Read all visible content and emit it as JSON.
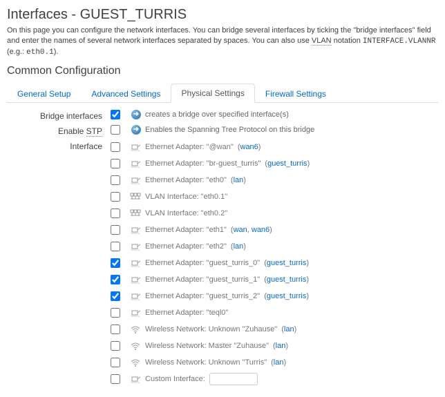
{
  "page": {
    "title": "Interfaces - GUEST_TURRIS",
    "description_pre": "On this page you can configure the network interfaces. You can bridge several interfaces by ticking the \"bridge interfaces\" field and enter the names of several network interfaces separated by spaces. You can also use ",
    "vlan_abbr": "VLAN",
    "description_mid": " notation ",
    "notation": "INTERFACE.VLANNR",
    "description_eg": " (e.g.: ",
    "notation_example": "eth0.1",
    "description_end": ").",
    "section_title": "Common Configuration"
  },
  "tabs": [
    {
      "label": "General Setup",
      "active": false
    },
    {
      "label": "Advanced Settings",
      "active": false
    },
    {
      "label": "Physical Settings",
      "active": true
    },
    {
      "label": "Firewall Settings",
      "active": false
    }
  ],
  "fields": {
    "bridge": {
      "label": "Bridge interfaces",
      "checked": true,
      "hint": "creates a bridge over specified interface(s)"
    },
    "stp": {
      "label_pre": "Enable ",
      "label_abbr": "STP",
      "checked": false,
      "hint": "Enables the Spanning Tree Protocol on this bridge"
    },
    "interface": {
      "label": "Interface"
    }
  },
  "interfaces": [
    {
      "checked": false,
      "icon": "eth",
      "text": "Ethernet Adapter: \"@wan\"",
      "nets": [
        "wan6"
      ]
    },
    {
      "checked": false,
      "icon": "eth",
      "text": "Ethernet Adapter: \"br-guest_turris\"",
      "nets": [
        "guest_turris"
      ]
    },
    {
      "checked": false,
      "icon": "eth",
      "text": "Ethernet Adapter: \"eth0\"",
      "nets": [
        "lan"
      ]
    },
    {
      "checked": false,
      "icon": "vlan",
      "text": "VLAN Interface: \"eth0.1\"",
      "nets": []
    },
    {
      "checked": false,
      "icon": "vlan",
      "text": "VLAN Interface: \"eth0.2\"",
      "nets": []
    },
    {
      "checked": false,
      "icon": "eth",
      "text": "Ethernet Adapter: \"eth1\"",
      "nets": [
        "wan",
        "wan6"
      ]
    },
    {
      "checked": false,
      "icon": "eth",
      "text": "Ethernet Adapter: \"eth2\"",
      "nets": [
        "lan"
      ]
    },
    {
      "checked": true,
      "icon": "eth",
      "text": "Ethernet Adapter: \"guest_turris_0\"",
      "nets": [
        "guest_turris"
      ]
    },
    {
      "checked": true,
      "icon": "eth",
      "text": "Ethernet Adapter: \"guest_turris_1\"",
      "nets": [
        "guest_turris"
      ]
    },
    {
      "checked": true,
      "icon": "eth",
      "text": "Ethernet Adapter: \"guest_turris_2\"",
      "nets": [
        "guest_turris"
      ]
    },
    {
      "checked": false,
      "icon": "eth",
      "text": "Ethernet Adapter: \"teql0\"",
      "nets": []
    },
    {
      "checked": false,
      "icon": "wifi",
      "text": "Wireless Network: Unknown \"Zuhause\"",
      "nets": [
        "lan"
      ]
    },
    {
      "checked": false,
      "icon": "wifi",
      "text": "Wireless Network: Master \"Zuhause\"",
      "nets": [
        "lan"
      ]
    },
    {
      "checked": false,
      "icon": "wifi",
      "text": "Wireless Network: Unknown \"Turris\"",
      "nets": [
        "lan"
      ]
    }
  ],
  "custom": {
    "label": "Custom Interface:",
    "value": ""
  }
}
